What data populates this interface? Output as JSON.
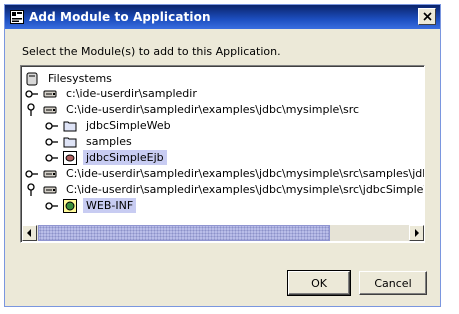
{
  "window": {
    "title": "Add Module to Application",
    "close_symbol": "×"
  },
  "instruction": "Select the Module(s) to add to this Application.",
  "tree": [
    {
      "label": "Filesystems",
      "icon": "filesystems-icon",
      "toggle": "none",
      "selected": false
    },
    {
      "label": "c:\\ide-userdir\\sampledir",
      "icon": "drive-icon",
      "toggle": "collapsed",
      "selected": false
    },
    {
      "label": "C:\\ide-userdir\\sampledir\\examples\\jdbc\\mysimple\\src",
      "icon": "drive-icon",
      "toggle": "expanded",
      "selected": false
    },
    {
      "label": "jdbcSimpleWeb",
      "icon": "folder-icon",
      "toggle": "collapsed",
      "selected": false
    },
    {
      "label": "samples",
      "icon": "folder-icon",
      "toggle": "collapsed",
      "selected": false
    },
    {
      "label": "jdbcSimpleEjb",
      "icon": "ejb-module-icon",
      "toggle": "collapsed",
      "selected": true
    },
    {
      "label": "C:\\ide-userdir\\sampledir\\examples\\jdbc\\mysimple\\src\\samples\\jdbc\\simple",
      "icon": "drive-icon",
      "toggle": "collapsed",
      "selected": false
    },
    {
      "label": "C:\\ide-userdir\\sampledir\\examples\\jdbc\\mysimple\\src\\jdbcSimpleWeb",
      "icon": "drive-icon",
      "toggle": "expanded",
      "selected": false
    },
    {
      "label": "WEB-INF",
      "icon": "web-module-icon",
      "toggle": "collapsed",
      "selected": true
    }
  ],
  "buttons": {
    "ok": "OK",
    "cancel": "Cancel"
  },
  "colors": {
    "titlebar": "#0a246a",
    "selection": "#c8ccf2",
    "dialog": "#ece9d8"
  }
}
